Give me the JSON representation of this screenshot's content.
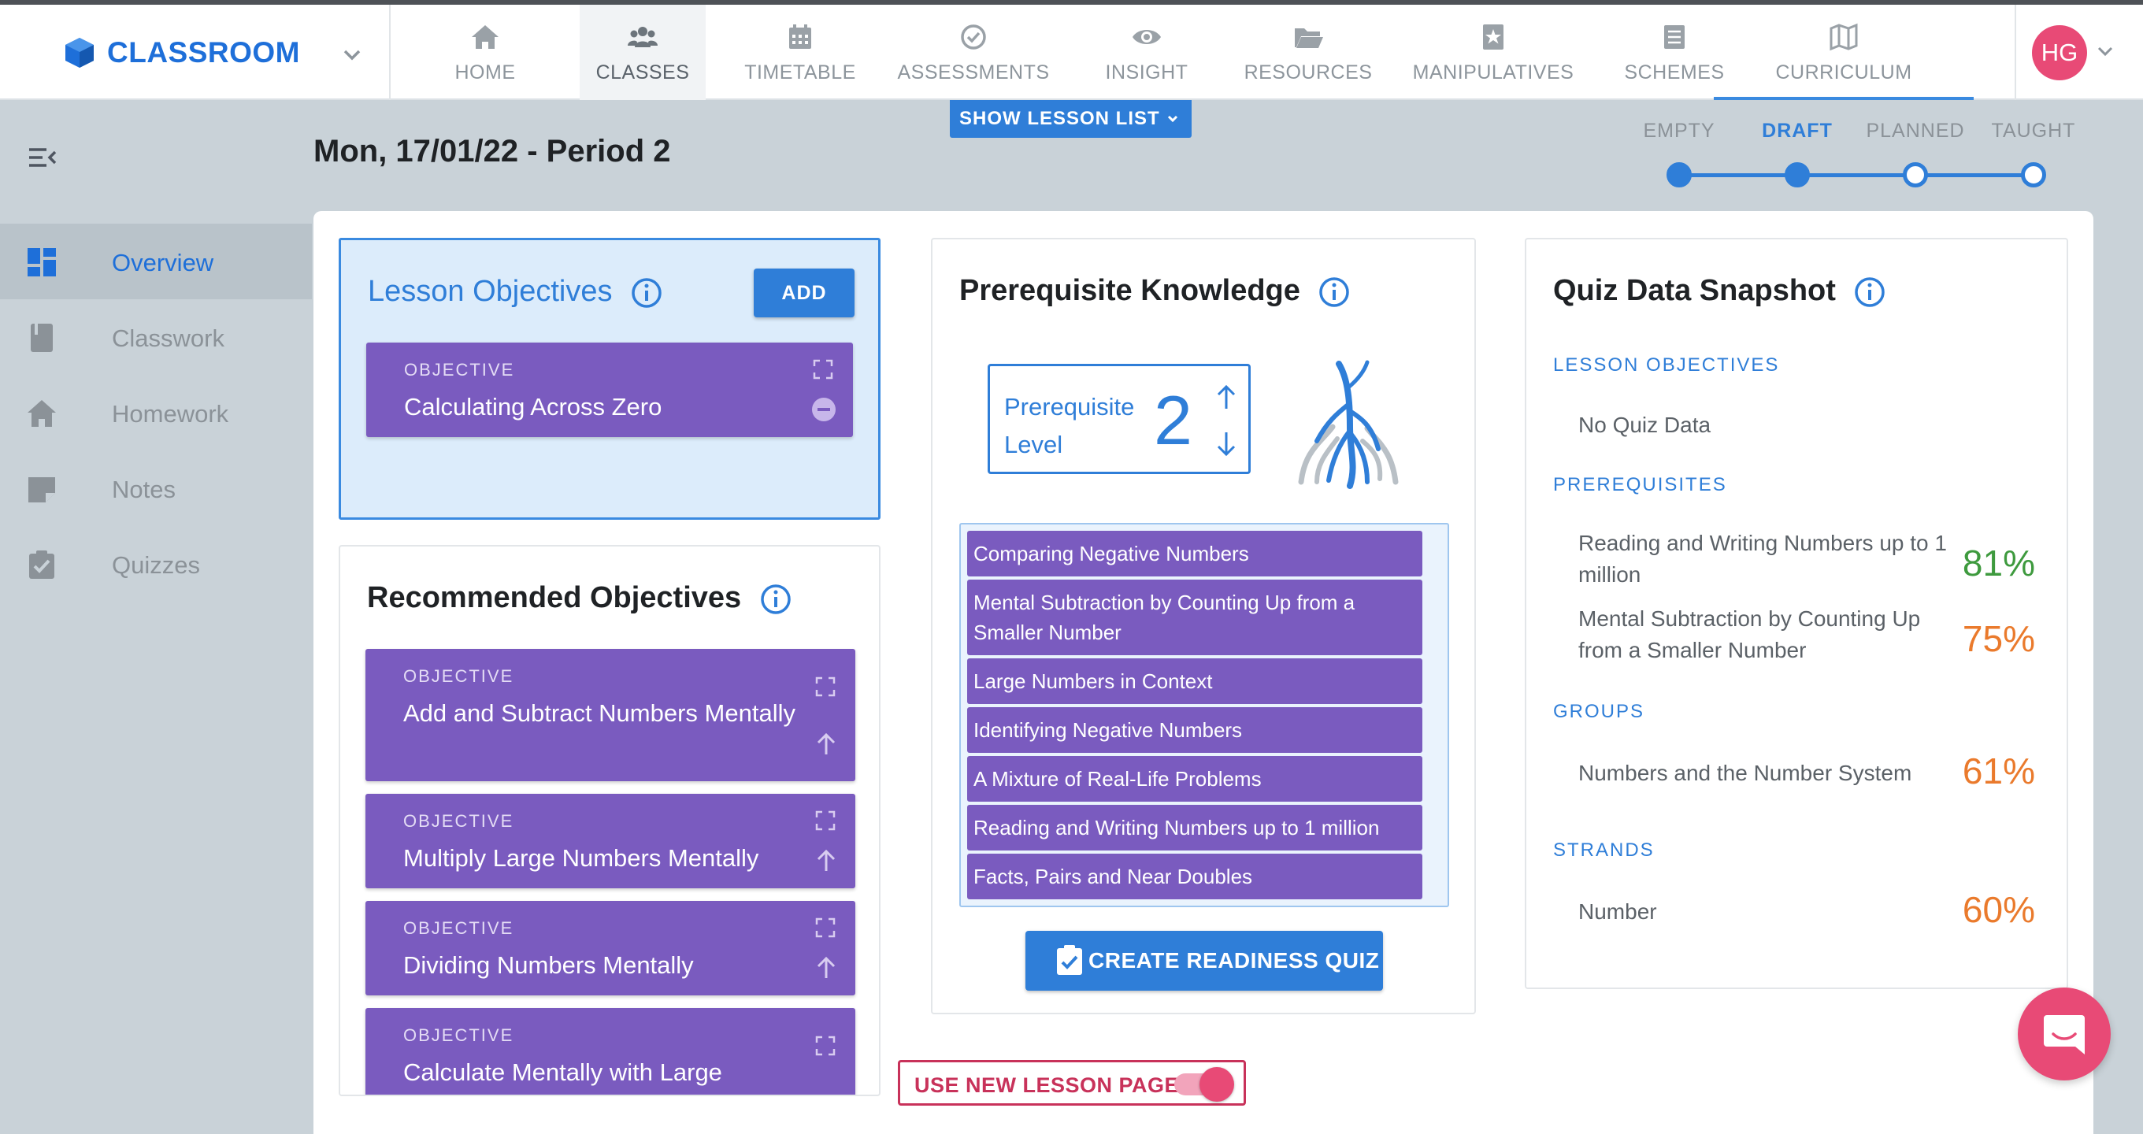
{
  "brand": {
    "name": "CLASSROOM"
  },
  "nav": {
    "tabs": [
      {
        "label": "HOME",
        "icon": "home-icon"
      },
      {
        "label": "CLASSES",
        "icon": "users-icon"
      },
      {
        "label": "TIMETABLE",
        "icon": "calendar-icon"
      },
      {
        "label": "ASSESSMENTS",
        "icon": "check-circle-icon"
      },
      {
        "label": "INSIGHT",
        "icon": "eye-icon"
      },
      {
        "label": "RESOURCES",
        "icon": "folder-open-icon"
      },
      {
        "label": "MANIPULATIVES",
        "icon": "star-box-icon"
      },
      {
        "label": "SCHEMES",
        "icon": "list-box-icon"
      },
      {
        "label": "CURRICULUM",
        "icon": "map-icon"
      }
    ],
    "active_tab": "CLASSES",
    "avatar_initials": "HG"
  },
  "sidebar": {
    "items": [
      {
        "label": "Overview",
        "icon": "dashboard-icon"
      },
      {
        "label": "Classwork",
        "icon": "book-icon"
      },
      {
        "label": "Homework",
        "icon": "house-icon"
      },
      {
        "label": "Notes",
        "icon": "note-icon"
      },
      {
        "label": "Quizzes",
        "icon": "clipboard-check-icon"
      }
    ],
    "active_item": "Overview"
  },
  "header": {
    "title": "Mon, 17/01/22 - Period 2",
    "show_lesson_list": "SHOW LESSON LIST"
  },
  "status_stepper": {
    "steps": [
      "EMPTY",
      "DRAFT",
      "PLANNED",
      "TAUGHT"
    ],
    "current": "DRAFT"
  },
  "lesson_objectives": {
    "title": "Lesson Objectives",
    "add_label": "ADD",
    "items": [
      {
        "type": "OBJECTIVE",
        "name": "Calculating Across Zero"
      }
    ]
  },
  "recommended_objectives": {
    "title": "Recommended Objectives",
    "items": [
      {
        "type": "OBJECTIVE",
        "name": "Add and Subtract Numbers Mentally"
      },
      {
        "type": "OBJECTIVE",
        "name": "Multiply Large Numbers Mentally"
      },
      {
        "type": "OBJECTIVE",
        "name": "Dividing Numbers Mentally"
      },
      {
        "type": "OBJECTIVE",
        "name": "Calculate Mentally with Large"
      }
    ]
  },
  "prerequisite": {
    "title": "Prerequisite Knowledge",
    "level_label": "Prerequisite Level",
    "level_value": "2",
    "items": [
      "Comparing Negative Numbers",
      "Mental Subtraction by Counting Up from a Smaller Number",
      "Large Numbers in Context",
      "Identifying Negative Numbers",
      "A Mixture of Real-Life Problems",
      "Reading and Writing Numbers up to 1 million",
      "Facts, Pairs and Near Doubles"
    ],
    "quiz_button": "CREATE READINESS QUIZ"
  },
  "quiz_snapshot": {
    "title": "Quiz Data Snapshot",
    "sections": {
      "lesson_objectives": {
        "label": "LESSON OBJECTIVES",
        "empty_text": "No Quiz Data"
      },
      "prerequisites": {
        "label": "PREREQUISITES",
        "rows": [
          {
            "name": "Reading and Writing Numbers up to 1 million",
            "percent": "81%",
            "color": "#3e9a3e"
          },
          {
            "name": "Mental Subtraction by Counting Up from a Smaller Number",
            "percent": "75%",
            "color": "#ea7a2c"
          }
        ]
      },
      "groups": {
        "label": "GROUPS",
        "rows": [
          {
            "name": "Numbers and the Number System",
            "percent": "61%",
            "color": "#ea7a2c"
          }
        ]
      },
      "strands": {
        "label": "STRANDS",
        "rows": [
          {
            "name": "Number",
            "percent": "60%",
            "color": "#ea7a2c"
          }
        ]
      }
    }
  },
  "toggle": {
    "label": "USE NEW LESSON PAGE",
    "on": true
  },
  "colors": {
    "accent": "#2f7ed8",
    "objective": "#7a5bbf",
    "brand_pink": "#e84a76"
  }
}
